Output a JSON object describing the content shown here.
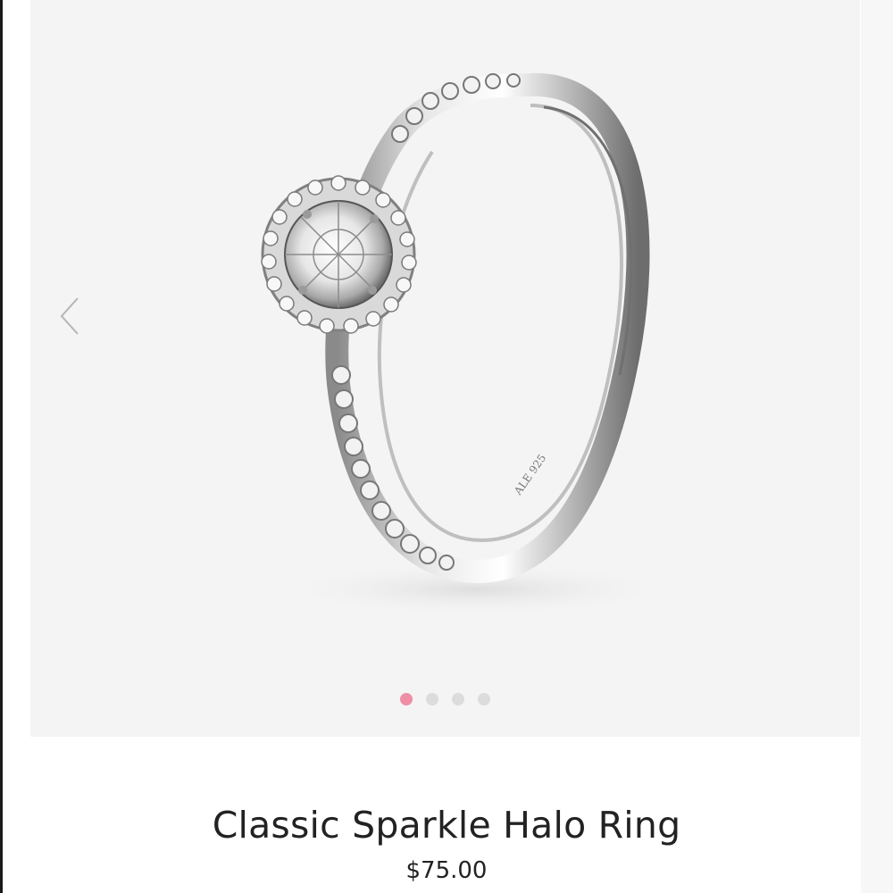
{
  "product": {
    "title": "Classic Sparkle Halo Ring",
    "price": "$75.00"
  },
  "gallery": {
    "image": "ring-photo",
    "prev_icon": "chevron-left-icon",
    "next_icon": "chevron-right-icon",
    "slide_count": 4,
    "active_slide": 1,
    "dots": [
      {
        "active": true
      },
      {
        "active": false
      },
      {
        "active": false
      },
      {
        "active": false
      }
    ]
  },
  "colors": {
    "background": "#ffffff",
    "gallery_background": "#f4f4f4",
    "active_dot": "#ee8fa6",
    "inactive_dot": "#dcdcdc",
    "text": "#222222"
  }
}
